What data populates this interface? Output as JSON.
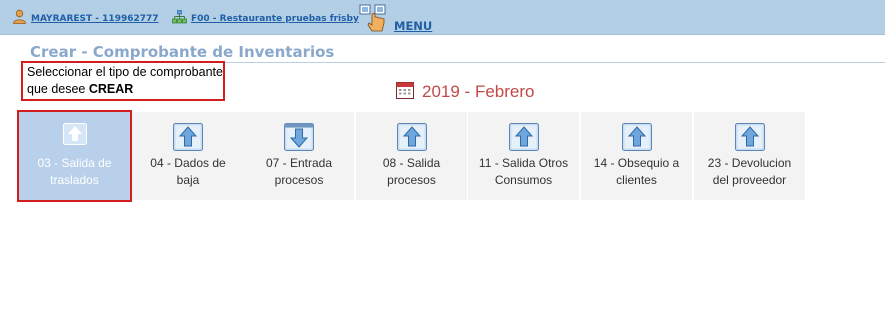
{
  "topbar": {
    "user_label": "MAYRAREST - 119962777",
    "company_label": "F00 - Restaurante pruebas frisby",
    "menu_label": "MENU"
  },
  "page": {
    "title": "Crear - Comprobante de Inventarios"
  },
  "notice": {
    "text_before": "Seleccionar el tipo de comprobante que desee ",
    "text_bold": "CREAR"
  },
  "period": {
    "year": "2019",
    "separator": " - ",
    "month": "Febrero"
  },
  "tiles": [
    {
      "line1": "03 - Salida de",
      "line2": "traslados",
      "icon": "arrow-up-icon",
      "selected": true
    },
    {
      "line1": "04 - Dados de",
      "line2": "baja",
      "icon": "arrow-up-icon",
      "selected": false
    },
    {
      "line1": "07 - Entrada",
      "line2": "procesos",
      "icon": "arrow-down-icon",
      "selected": false
    },
    {
      "line1": "08 - Salida",
      "line2": "procesos",
      "icon": "arrow-up-icon",
      "selected": false
    },
    {
      "line1": "11 - Salida Otros",
      "line2": "Consumos",
      "icon": "arrow-up-icon",
      "selected": false
    },
    {
      "line1": "14 - Obsequio a",
      "line2": "clientes",
      "icon": "arrow-up-icon",
      "selected": false
    },
    {
      "line1": "23 - Devolucion",
      "line2": "del proveedor",
      "icon": "arrow-up-icon",
      "selected": false
    }
  ],
  "colors": {
    "topbar_bg": "#b3cfe6",
    "link": "#1f5fa6",
    "title": "#8aa8cc",
    "period": "#c14a48",
    "highlight": "#d21e1e",
    "selected_tile": "#b8d0ea"
  }
}
